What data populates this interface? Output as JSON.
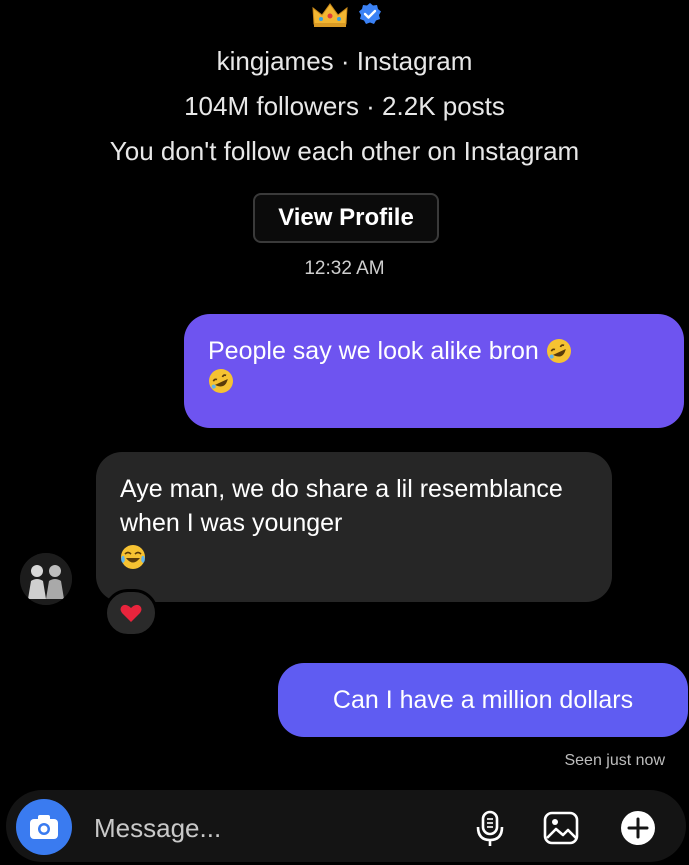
{
  "header": {
    "handle_line": "kingjames · Instagram",
    "stats_line": "104M followers · 2.2K posts",
    "follow_line": "You don't follow each other on Instagram",
    "view_profile_label": "View Profile",
    "timestamp": "12:32 AM"
  },
  "messages": [
    {
      "direction": "outgoing",
      "text": "People say we look alike bron",
      "emoji": "rolling-on-floor-laughing"
    },
    {
      "direction": "incoming",
      "text": "Aye man, we do share a lil resemblance when I was younger",
      "emoji": "face-with-tears-of-joy",
      "reaction": "red-heart"
    },
    {
      "direction": "outgoing",
      "text": "Can I have a million dollars"
    }
  ],
  "status": {
    "seen": "Seen just now"
  },
  "composer": {
    "placeholder": "Message..."
  },
  "colors": {
    "outgoing_bubble": "#6e54f0",
    "incoming_bubble": "#262626",
    "camera_button": "#3a7bf0",
    "verified": "#3b82f6"
  }
}
